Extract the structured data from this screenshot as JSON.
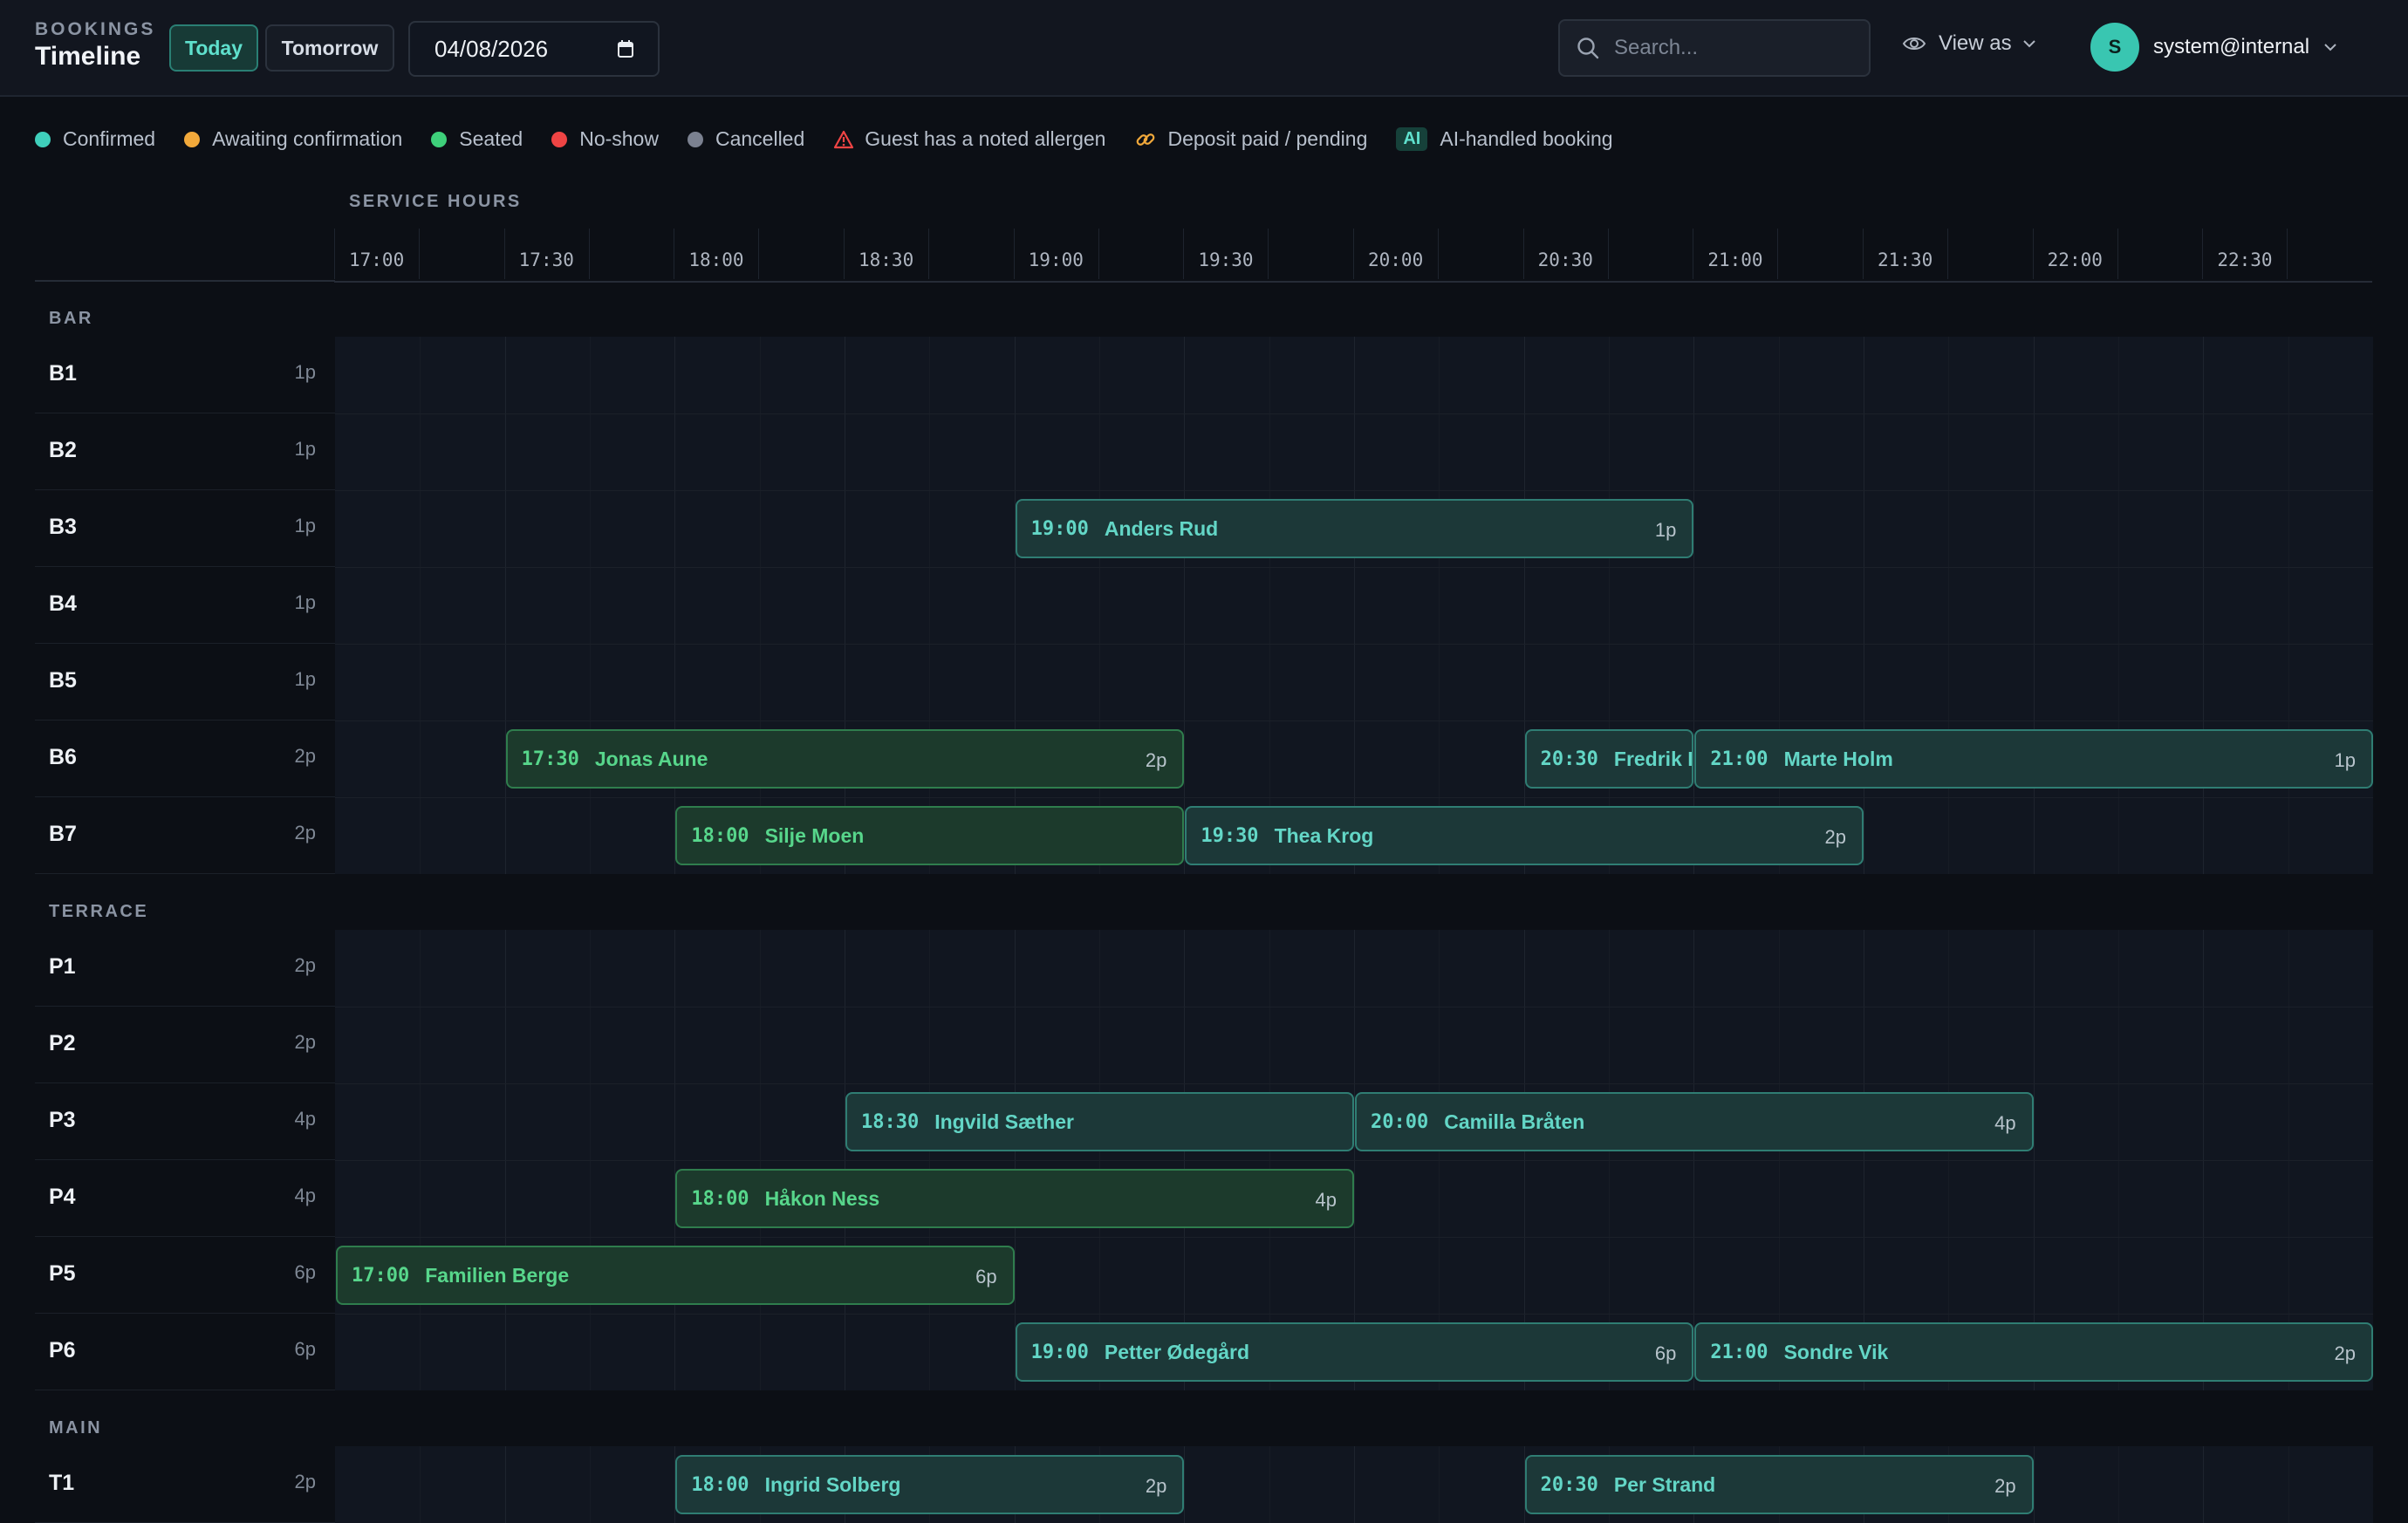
{
  "header": {
    "section": "BOOKINGS",
    "title": "Timeline",
    "today_label": "Today",
    "tomorrow_label": "Tomorrow",
    "date_value": "04/08/2026",
    "search_placeholder": "Search...",
    "view_as_label": "View as",
    "user_initial": "S",
    "user_email": "system@internal"
  },
  "legend": [
    {
      "label": "Confirmed",
      "kind": "dot",
      "color": "#3fcfbb"
    },
    {
      "label": "Awaiting confirmation",
      "kind": "dot",
      "color": "#f2a93b"
    },
    {
      "label": "Seated",
      "kind": "dot",
      "color": "#3ed07a"
    },
    {
      "label": "No-show",
      "kind": "dot",
      "color": "#ef4444"
    },
    {
      "label": "Cancelled",
      "kind": "dot",
      "color": "#7b8190"
    },
    {
      "label": "Guest has a noted allergen",
      "kind": "warning-icon",
      "color": "#ef4444"
    },
    {
      "label": "Deposit paid / pending",
      "kind": "link-icon",
      "color": "#f2a93b"
    },
    {
      "label": "AI-handled booking",
      "kind": "ai-badge",
      "badge": "AI"
    }
  ],
  "timeline": {
    "label": "SERVICE HOURS",
    "start": "17:00",
    "end": "23:00",
    "ticks": [
      "17:00",
      "17:30",
      "18:00",
      "18:30",
      "19:00",
      "19:30",
      "20:00",
      "20:30",
      "21:00",
      "21:30",
      "22:00",
      "22:30"
    ]
  },
  "sections": [
    {
      "name": "BAR",
      "rows": [
        {
          "table": "B1",
          "capacity": "1p",
          "bookings": []
        },
        {
          "table": "B2",
          "capacity": "1p",
          "bookings": []
        },
        {
          "table": "B3",
          "capacity": "1p",
          "bookings": [
            {
              "time": "19:00",
              "name": "Anders Rud",
              "party": "1p",
              "start": "19:00",
              "end": "21:00",
              "status": "confirmed"
            }
          ]
        },
        {
          "table": "B4",
          "capacity": "1p",
          "bookings": []
        },
        {
          "table": "B5",
          "capacity": "1p",
          "bookings": []
        },
        {
          "table": "B6",
          "capacity": "2p",
          "bookings": [
            {
              "time": "17:30",
              "name": "Jonas Aune",
              "party": "2p",
              "start": "17:30",
              "end": "19:30",
              "status": "seated"
            },
            {
              "time": "20:30",
              "name": "Fredrik L",
              "party": "",
              "start": "20:30",
              "end": "21:00",
              "status": "confirmed"
            },
            {
              "time": "21:00",
              "name": "Marte Holm",
              "party": "1p",
              "start": "21:00",
              "end": "23:00",
              "status": "confirmed"
            }
          ]
        },
        {
          "table": "B7",
          "capacity": "2p",
          "bookings": [
            {
              "time": "18:00",
              "name": "Silje Moen",
              "party": "",
              "start": "18:00",
              "end": "19:30",
              "status": "seated"
            },
            {
              "time": "19:30",
              "name": "Thea Krog",
              "party": "2p",
              "start": "19:30",
              "end": "21:30",
              "status": "confirmed"
            }
          ]
        }
      ]
    },
    {
      "name": "TERRACE",
      "rows": [
        {
          "table": "P1",
          "capacity": "2p",
          "bookings": []
        },
        {
          "table": "P2",
          "capacity": "2p",
          "bookings": []
        },
        {
          "table": "P3",
          "capacity": "4p",
          "bookings": [
            {
              "time": "18:30",
              "name": "Ingvild Sæther",
              "party": "",
              "start": "18:30",
              "end": "20:00",
              "status": "confirmed"
            },
            {
              "time": "20:00",
              "name": "Camilla Bråten",
              "party": "4p",
              "start": "20:00",
              "end": "22:00",
              "status": "confirmed"
            }
          ]
        },
        {
          "table": "P4",
          "capacity": "4p",
          "bookings": [
            {
              "time": "18:00",
              "name": "Håkon Ness",
              "party": "4p",
              "start": "18:00",
              "end": "20:00",
              "status": "seated"
            }
          ]
        },
        {
          "table": "P5",
          "capacity": "6p",
          "bookings": [
            {
              "time": "17:00",
              "name": "Familien Berge",
              "party": "6p",
              "start": "17:00",
              "end": "19:00",
              "status": "seated"
            }
          ]
        },
        {
          "table": "P6",
          "capacity": "6p",
          "bookings": [
            {
              "time": "19:00",
              "name": "Petter Ødegård",
              "party": "6p",
              "start": "19:00",
              "end": "21:00",
              "status": "confirmed"
            },
            {
              "time": "21:00",
              "name": "Sondre Vik",
              "party": "2p",
              "start": "21:00",
              "end": "23:00",
              "status": "confirmed"
            }
          ]
        }
      ]
    },
    {
      "name": "MAIN",
      "rows": [
        {
          "table": "T1",
          "capacity": "2p",
          "bookings": [
            {
              "time": "18:00",
              "name": "Ingrid Solberg",
              "party": "2p",
              "start": "18:00",
              "end": "19:30",
              "status": "confirmed"
            },
            {
              "time": "20:30",
              "name": "Per Strand",
              "party": "2p",
              "start": "20:30",
              "end": "22:00",
              "status": "confirmed"
            }
          ]
        }
      ]
    }
  ]
}
